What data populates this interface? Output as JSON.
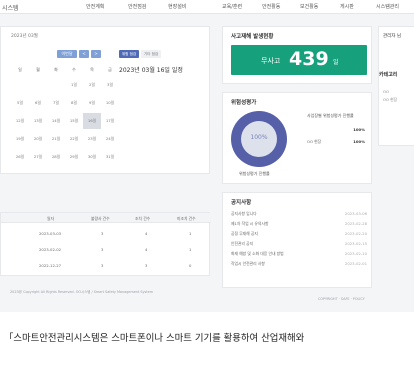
{
  "nav": {
    "brand": "시스템",
    "menu": [
      "안전계획",
      "안전점검",
      "현장설비",
      "교육/훈련",
      "안전활동",
      "보건활동",
      "게시판",
      "시스템관리"
    ]
  },
  "calendar": {
    "year_month": "2023년 03월",
    "nav_buttons": [
      "이번달",
      "<",
      ">"
    ],
    "tag_buttons": [
      "위험 점검",
      "기타 점검"
    ],
    "selected_date": "2023년 03월 16일 일정",
    "weekdays": [
      "일",
      "월",
      "화",
      "수",
      "목",
      "금"
    ],
    "weeks": [
      [
        "",
        "",
        "",
        "1일",
        "2일",
        "3일"
      ],
      [
        "5일",
        "6일",
        "7일",
        "8일",
        "9일",
        "10일"
      ],
      [
        "12일",
        "13일",
        "14일",
        "15일",
        "16일",
        "17일"
      ],
      [
        "19일",
        "20일",
        "21일",
        "22일",
        "23일",
        "24일"
      ],
      [
        "26일",
        "27일",
        "28일",
        "29일",
        "30일",
        "31일"
      ]
    ],
    "selected_cell": "16일"
  },
  "stats": {
    "title": "사고재해 발생현황",
    "label": "무사고",
    "value": "439",
    "unit": "일"
  },
  "risk": {
    "title": "위험성평가",
    "donut_percent": "100%",
    "donut_fill": 1.0,
    "donut_caption": "위험성평가 진행률",
    "rows_title": "사업장별 위험성평가 진행률",
    "rows": [
      {
        "label": "",
        "value": "100%"
      },
      {
        "label": "OO 현장",
        "value": "100%"
      }
    ]
  },
  "notices": {
    "title": "공지사항",
    "items": [
      {
        "title": "공지사항 입니다",
        "date": "2023-03-06"
      },
      {
        "title": "제1차 작업 시 유의사항",
        "date": "2023-02-28"
      },
      {
        "title": "공정 무재해 공지",
        "date": "2023-02-20"
      },
      {
        "title": "안전관리 공지",
        "date": "2023-02-15"
      },
      {
        "title": "화재 예방 및 소화 대응 안내 방법",
        "date": "2023-02-10"
      },
      {
        "title": "작업시 안전관리 사항",
        "date": "2023-02-01"
      }
    ]
  },
  "right_column": {
    "title": "관리자 님",
    "subtitle": "카테고리",
    "lines": [
      "OO",
      "OO 현장"
    ]
  },
  "table": {
    "columns": [
      "일자",
      "불량사 건수",
      "조치 건수",
      "미조치 건수"
    ],
    "rows": [
      {
        "date": "2023-03-03",
        "a": "3",
        "b": "4",
        "c": "1"
      },
      {
        "date": "2023-02-02",
        "a": "3",
        "b": "4",
        "c": "1"
      },
      {
        "date": "2022-12-27",
        "a": "3",
        "b": "3",
        "c": "0"
      }
    ]
  },
  "footer": {
    "left": "2023@ Copyright All Rights Reserved. OO시스템 / Smart Safety Management System",
    "right": "COPYRIGHT · SAFE · POLICY"
  },
  "caption": "「스마트안전관리시스템은 스마트폰이나 스마트 기기를 활용하여 산업재해와"
}
